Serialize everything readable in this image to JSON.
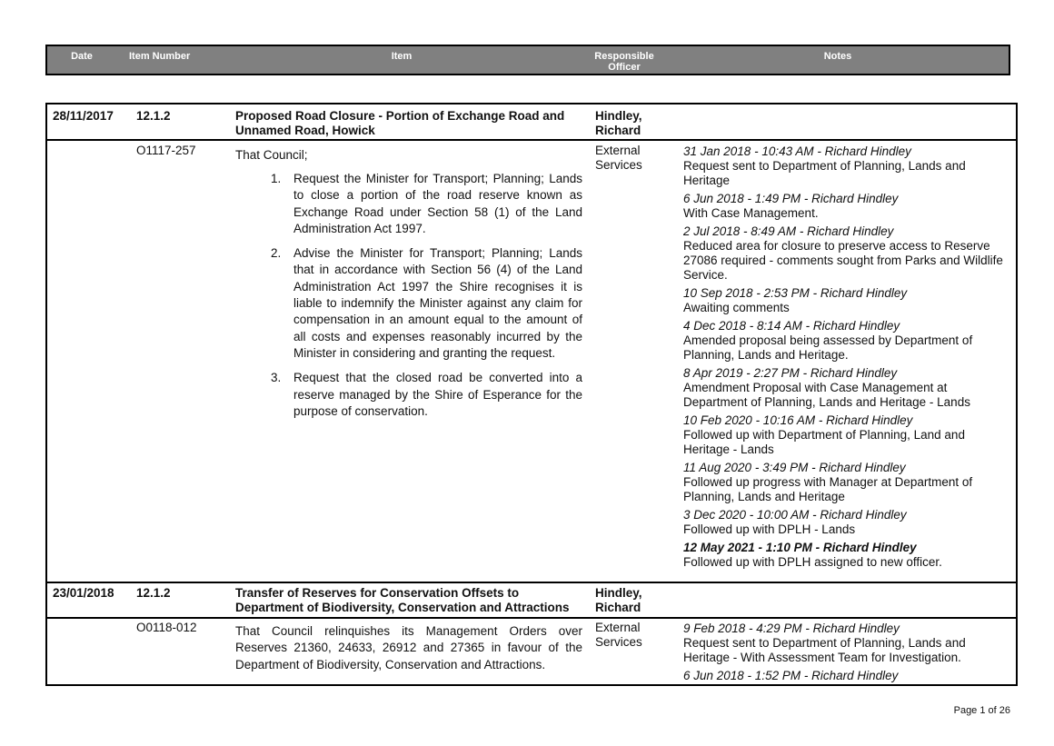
{
  "header": {
    "date": "Date",
    "item_number": "Item Number",
    "item": "Item",
    "responsible_officer_l1": "Responsible",
    "responsible_officer_l2": "Officer",
    "notes": "Notes"
  },
  "records": [
    {
      "date": "28/11/2017",
      "item_number": "12.1.2",
      "title_l1": "Proposed Road Closure - Portion of Exchange Road and",
      "title_l2": "Unnamed Road, Howick",
      "officer_l1": "Hindley,",
      "officer_l2": "Richard",
      "resolution_ref": "O1117-257",
      "department_l1": "External",
      "department_l2": "Services",
      "intro": "That Council;",
      "resolutions": [
        {
          "num": "1.",
          "text": "Request the Minister for Transport; Planning; Lands to close a portion of the road reserve known as Exchange Road under Section 58 (1) of the Land Administration Act 1997."
        },
        {
          "num": "2.",
          "text": "Advise the Minister for Transport; Planning; Lands that in accordance with Section 56 (4) of the Land Administration Act 1997 the Shire recognises it is liable to indemnify the Minister against any claim for compensation in an amount equal to the amount of all costs and expenses reasonably incurred by the Minister in considering and granting the request."
        },
        {
          "num": "3.",
          "text": "Request that the closed road be converted into a reserve managed by the Shire of Esperance for the purpose of conservation."
        }
      ],
      "notes": [
        {
          "heading": "31 Jan 2018 - 10:43 AM - Richard Hindley",
          "body_lines": [
            "Request sent to Department of Planning, Lands and",
            "Heritage"
          ]
        },
        {
          "heading": "6 Jun 2018 - 1:49 PM - Richard Hindley",
          "body_lines": [
            "With Case Management."
          ]
        },
        {
          "heading": "2 Jul 2018 - 8:49 AM - Richard Hindley",
          "body_lines": [
            "Reduced area for closure to preserve access to Reserve",
            "27086 required - comments sought from Parks and Wildlife",
            "Service."
          ]
        },
        {
          "heading": "10 Sep 2018 - 2:53 PM - Richard Hindley",
          "body_lines": [
            "Awaiting comments"
          ]
        },
        {
          "heading": "4 Dec 2018 - 8:14 AM - Richard Hindley",
          "body_lines": [
            "Amended proposal being assessed by Department of",
            "Planning, Lands and Heritage."
          ]
        },
        {
          "heading": "8 Apr 2019 - 2:27 PM - Richard Hindley",
          "body_lines": [
            "Amendment Proposal with Case Management at",
            "Department of Planning, Lands and Heritage - Lands"
          ]
        },
        {
          "heading": "10 Feb 2020 - 10:16 AM - Richard Hindley",
          "body_lines": [
            "Followed up with Department of Planning, Land and",
            "Heritage - Lands"
          ]
        },
        {
          "heading": "11 Aug 2020 - 3:49 PM - Richard Hindley",
          "body_lines": [
            "Followed up progress with Manager at Department of",
            "Planning, Lands and Heritage"
          ]
        },
        {
          "heading": "3 Dec 2020 - 10:00 AM - Richard Hindley",
          "body_lines": [
            "Followed up with DPLH - Lands"
          ]
        },
        {
          "heading": "12 May 2021 - 1:10 PM - Richard Hindley",
          "body_lines": [
            "Followed up with DPLH assigned to new officer."
          ]
        }
      ]
    },
    {
      "date": "23/01/2018",
      "item_number": "12.1.2",
      "title_l1": "Transfer of Reserves for Conservation Offsets to",
      "title_l2": "Department of Biodiversity, Conservation and Attractions",
      "officer_l1": "Hindley,",
      "officer_l2": "Richard",
      "resolution_ref": "O0118-012",
      "department_l1": "External",
      "department_l2": "Services",
      "resolution_text": "That Council relinquishes its Management Orders over Reserves 21360, 24633, 26912 and 27365 in favour of the Department of Biodiversity, Conservation and Attractions.",
      "notes": [
        {
          "heading": "9 Feb 2018 - 4:29 PM - Richard Hindley",
          "body_lines": [
            "Request sent to Department of Planning, Lands and",
            "Heritage - With Assessment Team for Investigation."
          ]
        },
        {
          "heading": "6 Jun 2018 - 1:52 PM - Richard Hindley",
          "body_lines": []
        }
      ]
    }
  ],
  "footer": {
    "page_label": "Page 1 of 26"
  }
}
